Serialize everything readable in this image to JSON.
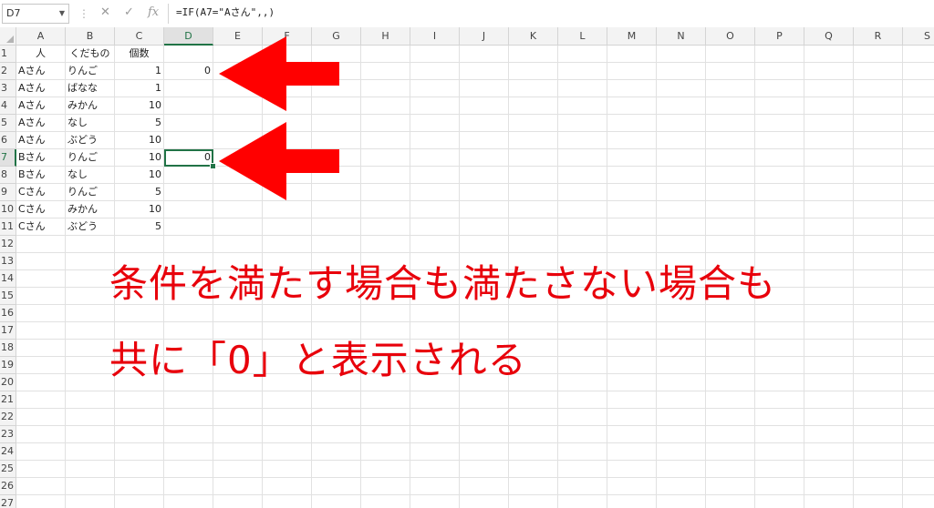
{
  "formula_bar": {
    "name_box": "D7",
    "formula": "=IF(A7=\"Aさん\",,)"
  },
  "columns": [
    "A",
    "B",
    "C",
    "D",
    "E",
    "F",
    "G",
    "H",
    "I",
    "J",
    "K",
    "L",
    "M",
    "N",
    "O",
    "P",
    "Q",
    "R",
    "S"
  ],
  "selected_column": "D",
  "rows": [
    "1",
    "2",
    "3",
    "4",
    "5",
    "6",
    "7",
    "8",
    "9",
    "10",
    "11",
    "12",
    "13",
    "14",
    "15",
    "16",
    "17",
    "18",
    "19",
    "20",
    "21",
    "22",
    "23",
    "24",
    "25",
    "26",
    "27"
  ],
  "selected_row": "7",
  "headers": {
    "a": "人",
    "b": "くだもの",
    "c": "個数"
  },
  "table": [
    {
      "a": "Aさん",
      "b": "りんご",
      "c": "1",
      "d": "0"
    },
    {
      "a": "Aさん",
      "b": "ばなな",
      "c": "1",
      "d": ""
    },
    {
      "a": "Aさん",
      "b": "みかん",
      "c": "10",
      "d": ""
    },
    {
      "a": "Aさん",
      "b": "なし",
      "c": "5",
      "d": ""
    },
    {
      "a": "Aさん",
      "b": "ぶどう",
      "c": "10",
      "d": ""
    },
    {
      "a": "Bさん",
      "b": "りんご",
      "c": "10",
      "d": "0"
    },
    {
      "a": "Bさん",
      "b": "なし",
      "c": "10",
      "d": ""
    },
    {
      "a": "Cさん",
      "b": "りんご",
      "c": "5",
      "d": ""
    },
    {
      "a": "Cさん",
      "b": "みかん",
      "c": "10",
      "d": ""
    },
    {
      "a": "Cさん",
      "b": "ぶどう",
      "c": "5",
      "d": ""
    }
  ],
  "annotation": {
    "line1": "条件を満たす場合も満たさない場合も",
    "line2": "共に「0」と表示される",
    "color": "#e8000b"
  },
  "accent_color": "#217346"
}
